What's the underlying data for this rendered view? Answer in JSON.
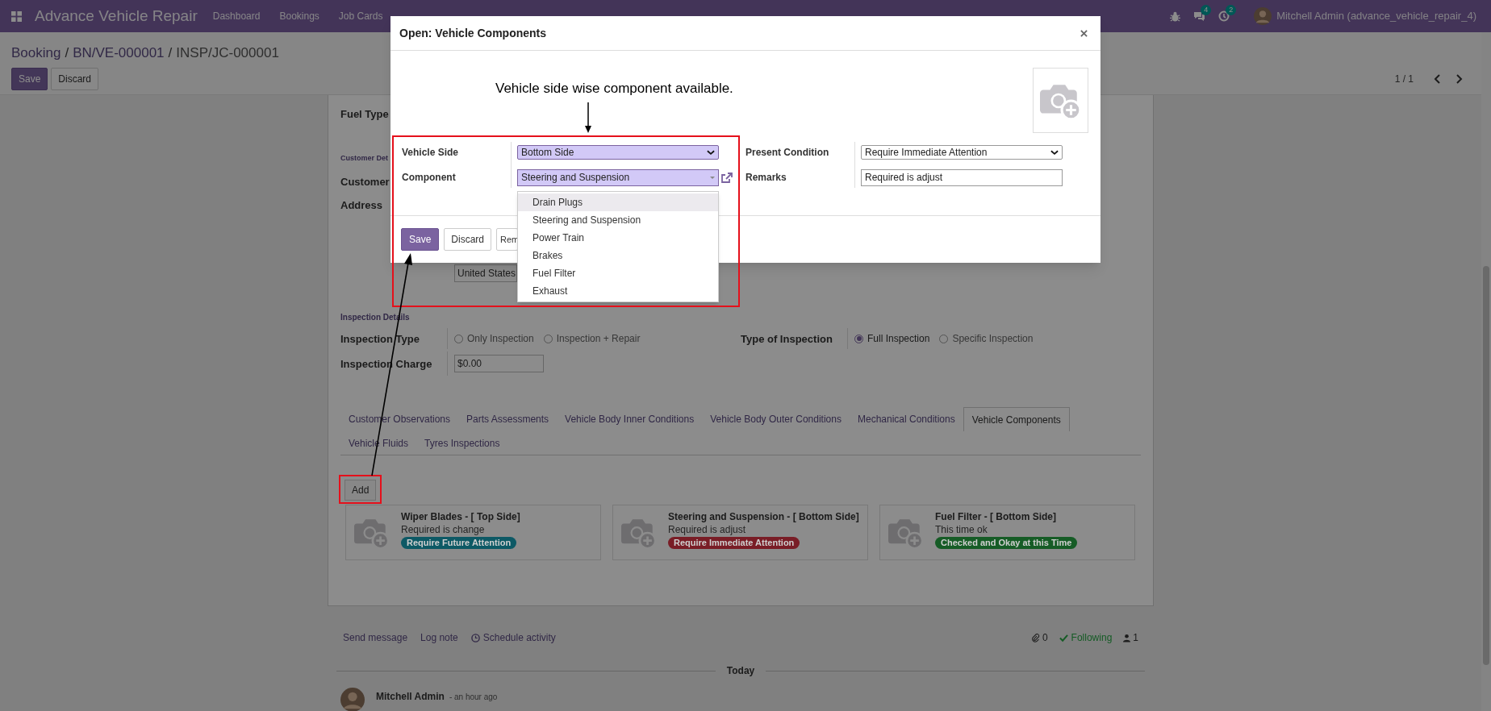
{
  "navbar": {
    "app_name": "Advance Vehicle Repair",
    "menu": [
      "Dashboard",
      "Bookings",
      "Job Cards"
    ],
    "notifications": [
      {
        "kind": "debug"
      },
      {
        "kind": "chat",
        "count": "4"
      },
      {
        "kind": "activity",
        "count": "2"
      }
    ],
    "user": "Mitchell Admin (advance_vehicle_repair_4)"
  },
  "breadcrumb": {
    "items": [
      "Booking",
      "BN/VE-000001",
      "INSP/JC-000001"
    ],
    "separator": "/"
  },
  "buttons": [
    {
      "label": "Save",
      "kind": "primary"
    },
    {
      "label": "Discard",
      "kind": "secondary"
    }
  ],
  "pager": "1 / 1",
  "form": {
    "fuel_type_label": "Fuel Type",
    "customer_section": "Customer Det",
    "customer_label": "Customer",
    "address_label": "Address",
    "country": "United States",
    "inspection_section": "Inspection Details",
    "inspection_type": {
      "label": "Inspection Type",
      "options": [
        {
          "label": "Only Inspection",
          "selected": false
        },
        {
          "label": "Inspection + Repair",
          "selected": false
        }
      ]
    },
    "type_of_inspection": {
      "label": "Type of Inspection",
      "options": [
        {
          "label": "Full Inspection",
          "selected": true
        },
        {
          "label": "Specific Inspection",
          "selected": false
        }
      ]
    },
    "inspection_charge": {
      "label": "Inspection Charge",
      "value": "$0.00"
    }
  },
  "tab_rows": [
    [
      {
        "label": "Customer Observations",
        "selected": false
      },
      {
        "label": "Parts Assessments",
        "selected": false
      },
      {
        "label": "Vehicle Body Inner Conditions",
        "selected": false
      },
      {
        "label": "Vehicle Body Outer Conditions",
        "selected": false
      },
      {
        "label": "Mechanical Conditions",
        "selected": false
      },
      {
        "label": "Vehicle Components",
        "selected": true
      }
    ],
    [
      {
        "label": "Vehicle Fluids",
        "selected": false
      },
      {
        "label": "Tyres Inspections",
        "selected": false
      }
    ]
  ],
  "add_button": "Add",
  "component_cards": [
    {
      "title": "Wiper Blades - [ Top Side]",
      "remarks": "Required is change",
      "condition": "Require Future Attention",
      "color": "#0d5965"
    },
    {
      "title": "Steering and Suspension - [ Bottom Side]",
      "remarks": "Required is adjust",
      "condition": "Require Immediate Attention",
      "color": "#791d26"
    },
    {
      "title": "Fuel Filter - [ Bottom Side]",
      "remarks": "This time ok",
      "condition": "Checked and Okay at this Time",
      "color": "#165c26"
    }
  ],
  "chatter": {
    "actions": [
      {
        "label": "Send message",
        "kind": "plain"
      },
      {
        "label": "Log note",
        "kind": "plain"
      },
      {
        "label": "Schedule activity",
        "kind": "clock"
      }
    ],
    "attachments": "0",
    "following": "Following",
    "followers": "1",
    "divider": "Today",
    "message": {
      "author": "Mitchell Admin",
      "time": "- an hour ago"
    }
  },
  "dialog": {
    "title": "Open: Vehicle Components",
    "columns": [
      [
        {
          "label": "Vehicle Side",
          "value": "Bottom Side",
          "kind": "select",
          "required": true
        },
        {
          "label": "Component",
          "value": "Steering and Suspension",
          "kind": "many2one",
          "required": true
        }
      ],
      [
        {
          "label": "Present Condition",
          "value": "Require Immediate Attention",
          "kind": "select",
          "required": false
        },
        {
          "label": "Remarks",
          "value": "Required is adjust",
          "kind": "text",
          "required": false
        }
      ]
    ],
    "buttons": [
      {
        "label": "Save",
        "kind": "primary"
      },
      {
        "label": "Discard",
        "kind": "secondary"
      },
      {
        "label": "Rem",
        "kind": "secondary"
      }
    ],
    "dropdown": [
      {
        "label": "Drain Plugs",
        "selected": true
      },
      {
        "label": "Steering and Suspension",
        "selected": false
      },
      {
        "label": "Power Train",
        "selected": false
      },
      {
        "label": "Brakes",
        "selected": false
      },
      {
        "label": "Fuel Filter",
        "selected": false
      },
      {
        "label": "Exhaust",
        "selected": false
      }
    ]
  },
  "annotation": {
    "note": "Vehicle side wise component available."
  }
}
